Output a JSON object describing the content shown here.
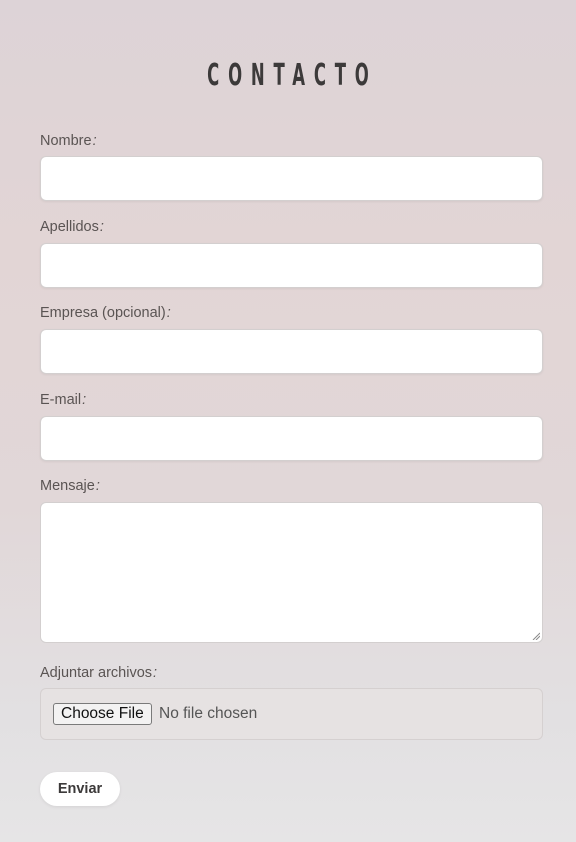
{
  "form": {
    "title": "CONTACTO",
    "fields": [
      {
        "label": "Nombre",
        "suffix": ":",
        "value": ""
      },
      {
        "label": "Apellidos",
        "suffix": ":",
        "value": ""
      },
      {
        "label": "Empresa (opcional)",
        "suffix": ":",
        "value": ""
      },
      {
        "label": "E-mail",
        "suffix": ":",
        "value": ""
      },
      {
        "label": "Mensaje",
        "suffix": ":",
        "value": ""
      }
    ],
    "attachments": {
      "label": "Adjuntar archivos",
      "suffix": ":",
      "button_label": "Choose File",
      "status": "No file chosen"
    },
    "submit_label": "Enviar"
  }
}
